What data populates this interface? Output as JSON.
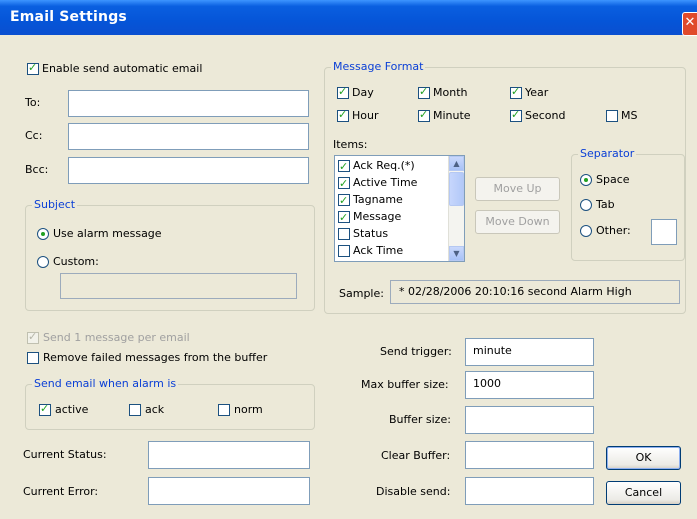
{
  "window": {
    "title": "Email Settings",
    "close_glyph": "✕"
  },
  "enable_auto": {
    "label": "Enable send automatic email",
    "checked": true
  },
  "recipients": {
    "to_label": "To:",
    "to_value": "",
    "cc_label": "Cc:",
    "cc_value": "",
    "bcc_label": "Bcc:",
    "bcc_value": ""
  },
  "subject": {
    "legend": "Subject",
    "use_alarm_label": "Use alarm message",
    "custom_label": "Custom:",
    "selected": "use_alarm",
    "custom_value": ""
  },
  "message_format": {
    "legend": "Message Format",
    "fields": [
      {
        "label": "Day",
        "checked": true
      },
      {
        "label": "Month",
        "checked": true
      },
      {
        "label": "Year",
        "checked": true
      },
      {
        "label": "Hour",
        "checked": true
      },
      {
        "label": "Minute",
        "checked": true
      },
      {
        "label": "Second",
        "checked": true
      },
      {
        "label": "MS",
        "checked": false
      }
    ],
    "items_label": "Items:",
    "items": [
      {
        "label": "Ack Req.(*)",
        "checked": true
      },
      {
        "label": "Active Time",
        "checked": true
      },
      {
        "label": "Tagname",
        "checked": true
      },
      {
        "label": "Message",
        "checked": true
      },
      {
        "label": "Status",
        "checked": false
      },
      {
        "label": "Ack Time",
        "checked": false
      }
    ],
    "move_up_label": "Move Up",
    "move_down_label": "Move Down",
    "separator": {
      "legend": "Separator",
      "space_label": "Space",
      "tab_label": "Tab",
      "other_label": "Other:",
      "selected": "space",
      "other_value": ""
    },
    "sample_label": "Sample:",
    "sample_value": "* 02/28/2006 20:10:16 second Alarm High"
  },
  "options": {
    "send_one_label": "Send 1 message per email",
    "send_one_checked": true,
    "send_one_disabled": true,
    "remove_failed_label": "Remove failed messages from the buffer",
    "remove_failed_checked": false
  },
  "send_when": {
    "legend": "Send email when alarm is",
    "active_label": "active",
    "active_checked": true,
    "ack_label": "ack",
    "ack_checked": false,
    "norm_label": "norm",
    "norm_checked": false
  },
  "status": {
    "current_status_label": "Current Status:",
    "current_status_value": "",
    "current_error_label": "Current Error:",
    "current_error_value": ""
  },
  "buffer": {
    "send_trigger_label": "Send trigger:",
    "send_trigger_value": "minute",
    "max_buffer_label": "Max buffer size:",
    "max_buffer_value": "1000",
    "buffer_size_label": "Buffer size:",
    "buffer_size_value": "",
    "clear_buffer_label": "Clear Buffer:",
    "clear_buffer_value": "",
    "disable_send_label": "Disable send:",
    "disable_send_value": ""
  },
  "buttons": {
    "ok_label": "OK",
    "cancel_label": "Cancel"
  },
  "colors": {
    "titlebar": "#0555d8",
    "legend_text": "#0a3fd6",
    "dialog_bg": "#ece9d8",
    "check_mark": "#21a121"
  }
}
